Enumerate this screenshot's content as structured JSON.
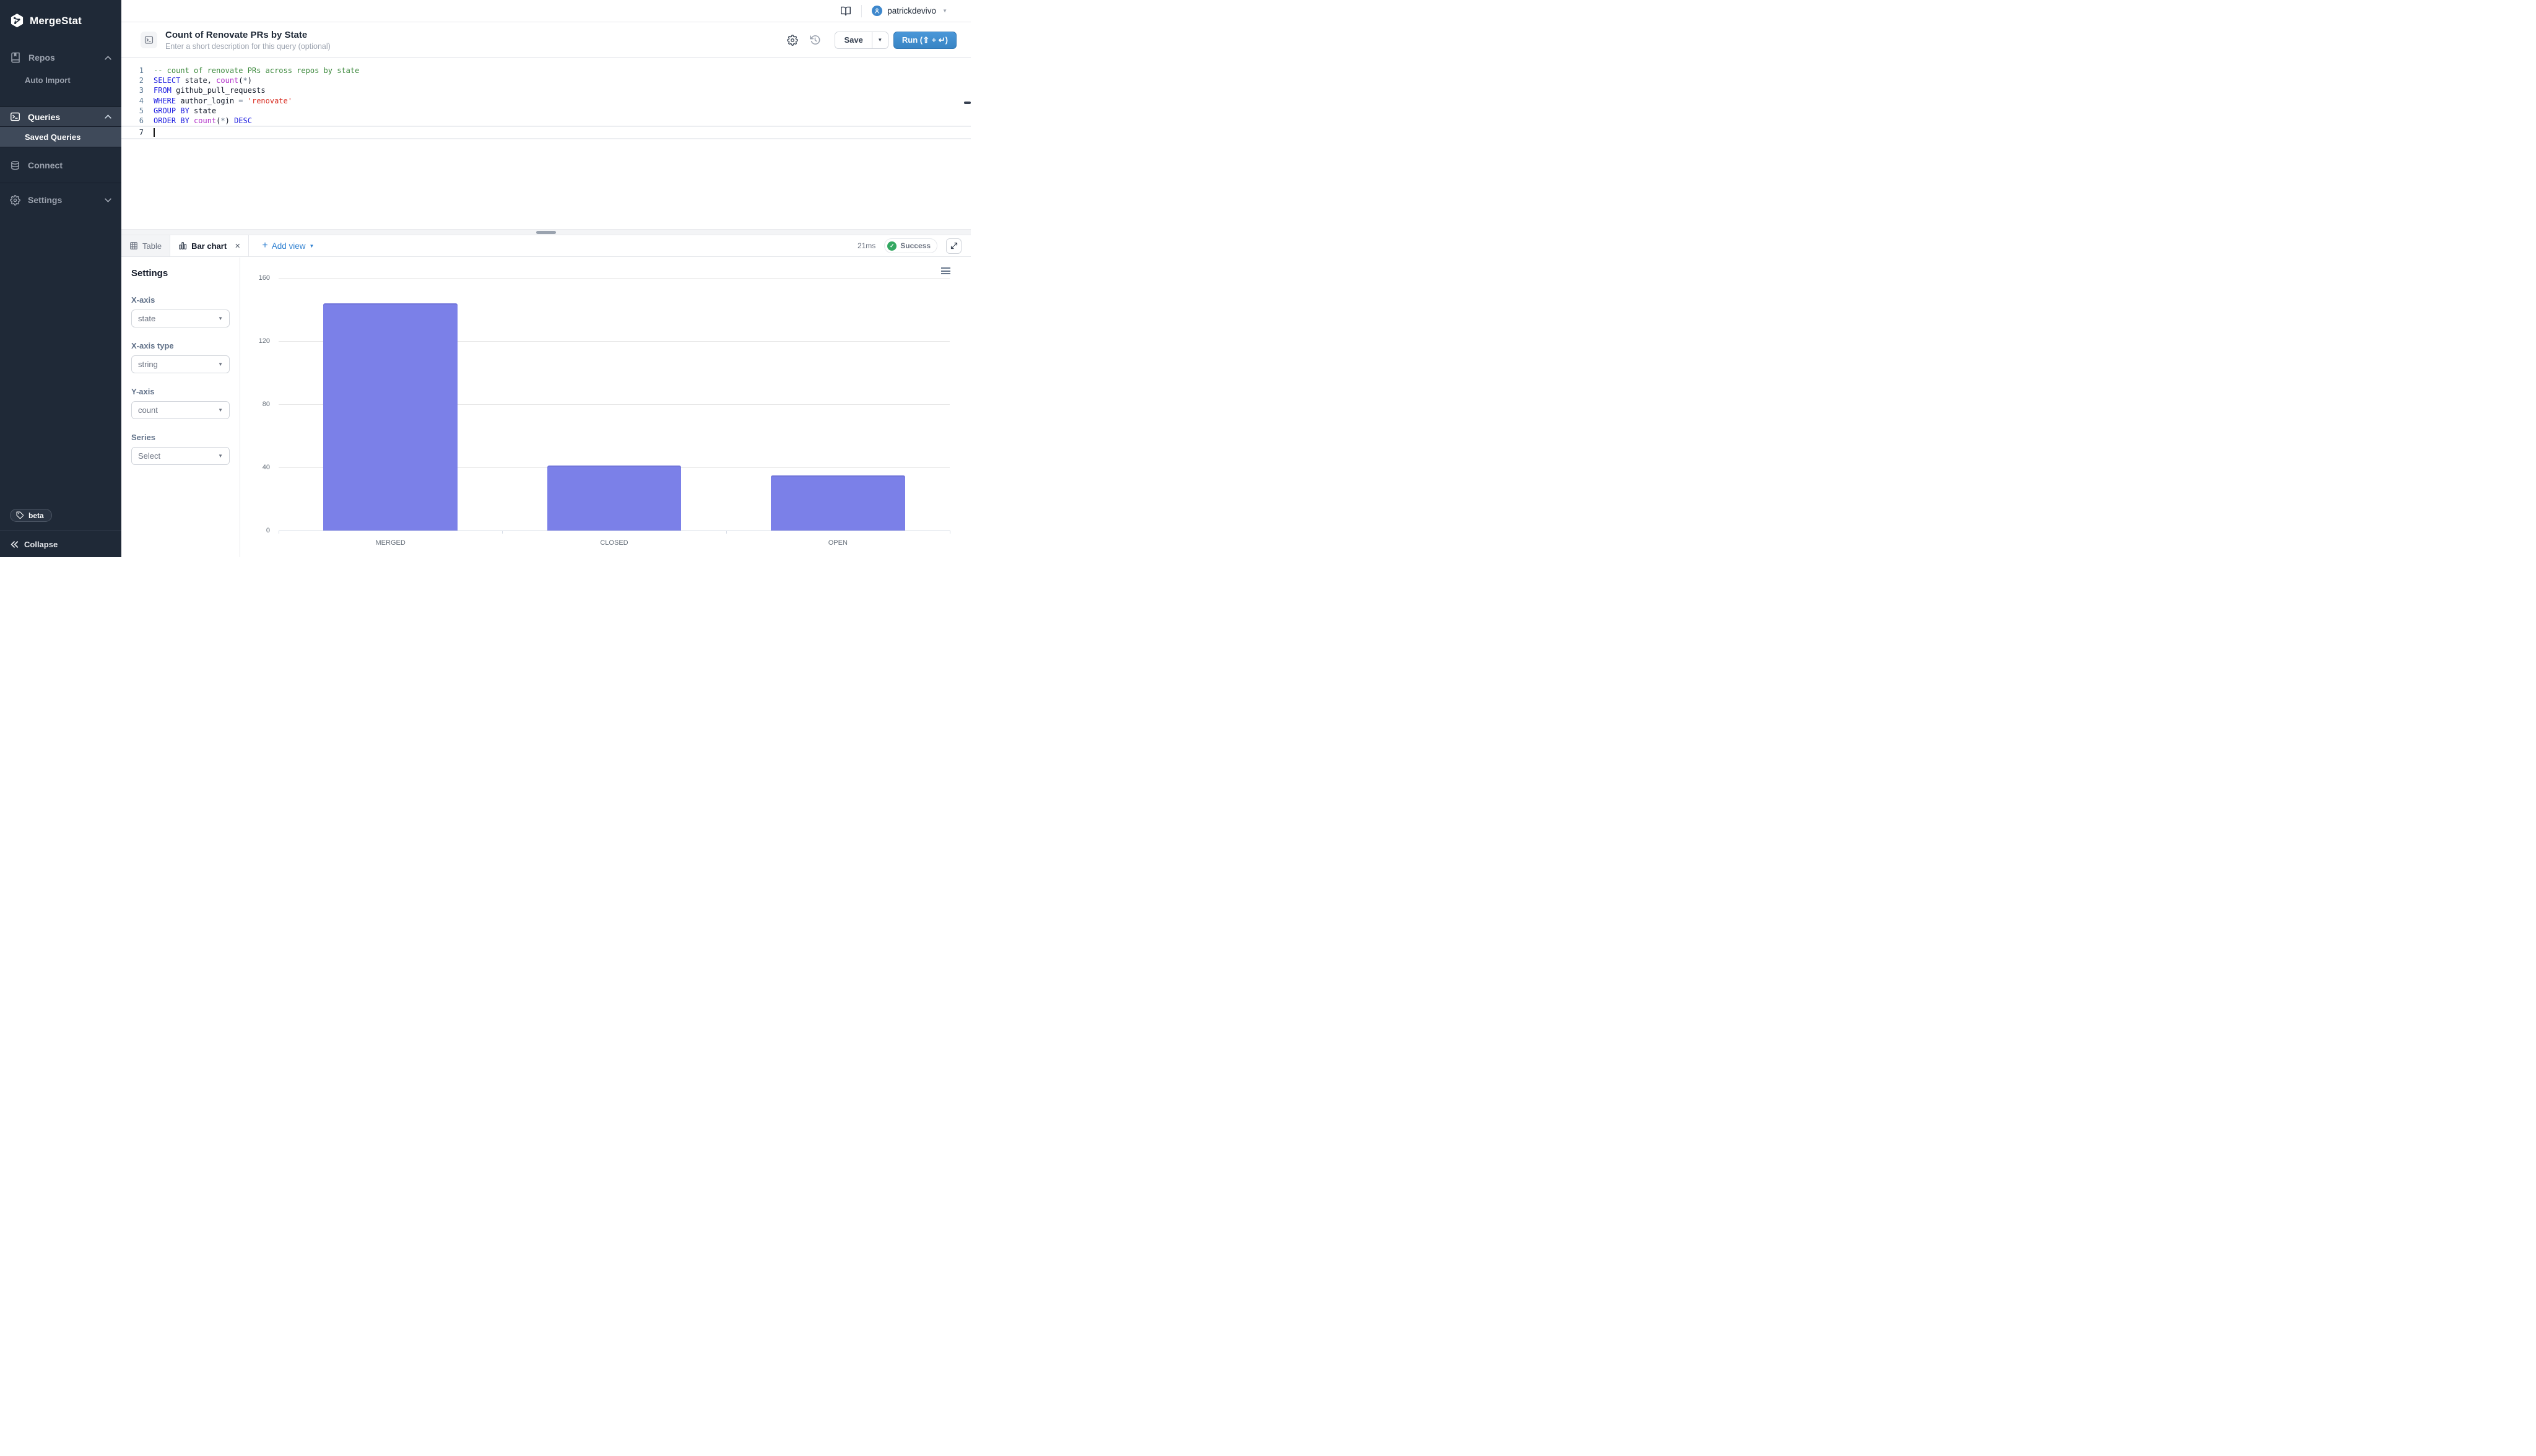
{
  "sidebar": {
    "brand": "MergeStat",
    "items": [
      {
        "label": "Repos",
        "icon": "book-icon",
        "chevron": "up"
      },
      {
        "label": "Auto Import",
        "indent": true
      },
      {
        "label": "Queries",
        "icon": "terminal-icon",
        "chevron": "up",
        "active": true
      },
      {
        "label": "Saved Queries",
        "indent": true,
        "active": true
      },
      {
        "label": "Connect",
        "icon": "database-icon"
      },
      {
        "label": "Settings",
        "icon": "gear-icon",
        "chevron": "down"
      }
    ],
    "beta_label": "beta",
    "collapse_label": "Collapse"
  },
  "topbar": {
    "username": "patrickdevivo"
  },
  "query_header": {
    "title": "Count of Renovate PRs by State",
    "description_placeholder": "Enter a short description for this query (optional)",
    "save_label": "Save",
    "run_label": "Run (⇧ + ↵)"
  },
  "editor": {
    "lines": [
      {
        "num": "1",
        "tokens": [
          {
            "t": "com",
            "v": "-- count of renovate PRs across repos by state"
          }
        ]
      },
      {
        "num": "2",
        "tokens": [
          {
            "t": "kw",
            "v": "SELECT"
          },
          {
            "t": "pl",
            "v": " state, "
          },
          {
            "t": "fn",
            "v": "count"
          },
          {
            "t": "pl",
            "v": "("
          },
          {
            "t": "op",
            "v": "*"
          },
          {
            "t": "pl",
            "v": ")"
          }
        ]
      },
      {
        "num": "3",
        "tokens": [
          {
            "t": "kw",
            "v": "FROM"
          },
          {
            "t": "pl",
            "v": " github_pull_requests"
          }
        ]
      },
      {
        "num": "4",
        "tokens": [
          {
            "t": "kw",
            "v": "WHERE"
          },
          {
            "t": "pl",
            "v": " author_login "
          },
          {
            "t": "op",
            "v": "="
          },
          {
            "t": "str",
            "v": " 'renovate'"
          }
        ]
      },
      {
        "num": "5",
        "tokens": [
          {
            "t": "kw",
            "v": "GROUP BY"
          },
          {
            "t": "pl",
            "v": " state"
          }
        ]
      },
      {
        "num": "6",
        "tokens": [
          {
            "t": "kw",
            "v": "ORDER BY "
          },
          {
            "t": "fn",
            "v": "count"
          },
          {
            "t": "pl",
            "v": "("
          },
          {
            "t": "op",
            "v": "*"
          },
          {
            "t": "pl",
            "v": ") "
          },
          {
            "t": "kw",
            "v": "DESC"
          }
        ]
      },
      {
        "num": "7",
        "tokens": [],
        "active": true
      }
    ]
  },
  "results": {
    "tabs": [
      {
        "label": "Table",
        "icon": "table-icon",
        "active": false
      },
      {
        "label": "Bar chart",
        "icon": "bar-chart-icon",
        "active": true,
        "closable": true
      }
    ],
    "add_view_label": "Add view",
    "runtime": "21ms",
    "status": "Success"
  },
  "settings_panel": {
    "title": "Settings",
    "fields": [
      {
        "label": "X-axis",
        "value": "state"
      },
      {
        "label": "X-axis type",
        "value": "string"
      },
      {
        "label": "Y-axis",
        "value": "count"
      },
      {
        "label": "Series",
        "value": "Select"
      }
    ]
  },
  "chart_data": {
    "type": "bar",
    "categories": [
      "MERGED",
      "CLOSED",
      "OPEN"
    ],
    "values": [
      144,
      41,
      35
    ],
    "title": "",
    "xlabel": "",
    "ylabel": "",
    "ylim": [
      0,
      160
    ],
    "yticks": [
      0,
      40,
      80,
      120,
      160
    ],
    "grid": true,
    "legend": false,
    "bar_color": "#7b80e8"
  },
  "colors": {
    "sidebar_bg": "#1f2937",
    "accent_blue": "#3e8cce",
    "link_blue": "#2d7fd0",
    "success_green": "#34a862",
    "bar_purple": "#7b80e8",
    "avatar_blue": "#3d87cc"
  }
}
